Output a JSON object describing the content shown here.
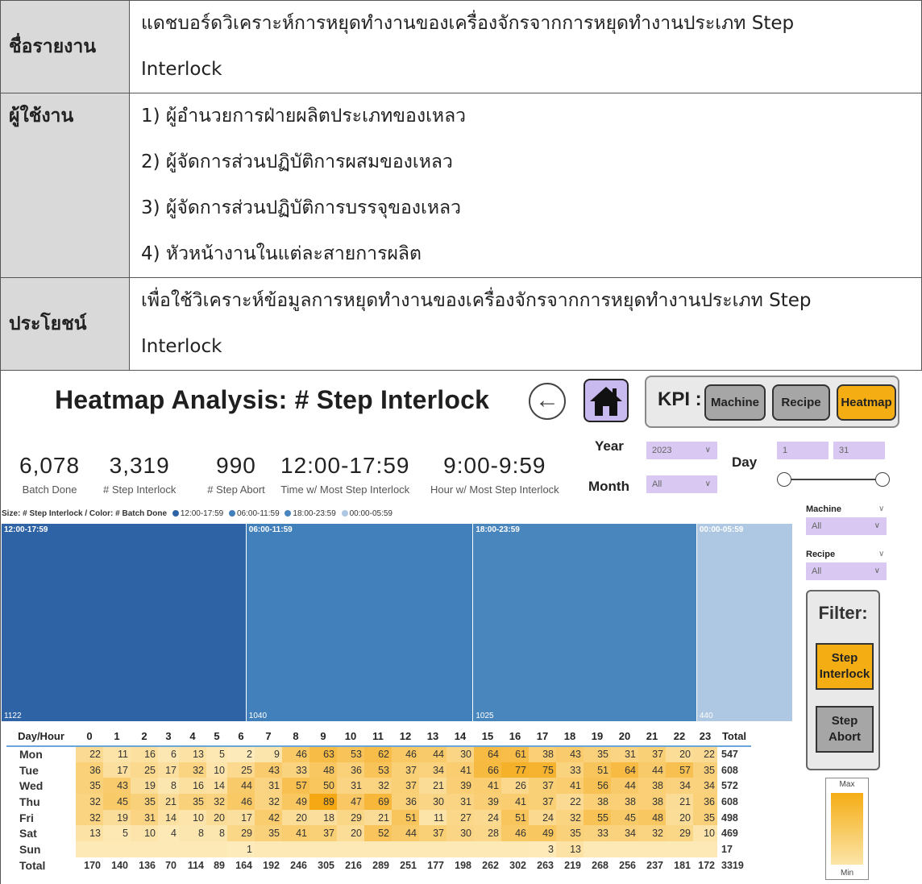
{
  "report": {
    "name_label": "ชื่อรายงาน",
    "name_value_1": "แดชบอร์ดวิเคราะห์การหยุดทำงานของเครื่องจักรจากการหยุดทำงานประเภท Step",
    "name_value_2": "Interlock",
    "users_label": "ผู้ใช้งาน",
    "users": [
      "1) ผู้อำนวยการฝ่ายผลิตประเภทของเหลว",
      "2) ผู้จัดการส่วนปฏิบัติการผสมของเหลว",
      "3) ผู้จัดการส่วนปฏิบัติการบรรจุของเหลว",
      "4) หัวหน้างานในแต่ละสายการผลิต"
    ],
    "benefit_label": "ประโยชน์",
    "benefit_value_1": "เพื่อใช้วิเคราะห์ข้อมูลการหยุดทำงานของเครื่องจักรจากการหยุดทำงานประเภท Step",
    "benefit_value_2": "Interlock"
  },
  "dashboard": {
    "title": "Heatmap Analysis: # Step Interlock",
    "back_icon": "arrow-left-circle-icon",
    "home_icon": "home-icon",
    "kpi": {
      "label": "KPI :",
      "buttons": [
        "Machine",
        "Recipe",
        "Heatmap"
      ],
      "active": "Heatmap"
    },
    "cards": [
      {
        "value": "6,078",
        "label": "Batch Done"
      },
      {
        "value": "3,319",
        "label": "# Step Interlock"
      },
      {
        "value": "990",
        "label": "# Step Abort"
      },
      {
        "value": "12:00-17:59",
        "label": "Time w/ Most Step Interlock"
      },
      {
        "value": "9:00-9:59",
        "label": "Hour w/ Most Step Interlock"
      }
    ],
    "filters": {
      "year_label": "Year",
      "year_value": "2023",
      "month_label": "Month",
      "month_value": "All",
      "day_label": "Day",
      "day_min": "1",
      "day_max": "31",
      "machine_label": "Machine",
      "machine_value": "All",
      "recipe_label": "Recipe",
      "recipe_value": "All"
    },
    "legend": {
      "title": "Size: # Step Interlock / Color: # Batch Done",
      "items": [
        "12:00-17:59",
        "06:00-11:59",
        "18:00-23:59",
        "00:00-05:59"
      ]
    },
    "filter_box": {
      "title": "Filter:",
      "buttons": [
        "Step Interlock",
        "Step Abort"
      ],
      "active": "Step Interlock"
    },
    "gauge": {
      "max": "Max",
      "min": "Min"
    },
    "colors": {
      "accent": "#f5ad14",
      "slicer": "#d9c9f2",
      "tm1": "#2e64a6",
      "tm2": "#4180bb",
      "tm3": "#4a86be",
      "tm4": "#aec7e2"
    }
  },
  "chart_data": [
    {
      "type": "treemap",
      "items": [
        {
          "label": "12:00-17:59",
          "value": 1122,
          "color": "#2e64a6"
        },
        {
          "label": "06:00-11:59",
          "value": 1040,
          "color": "#4180bb"
        },
        {
          "label": "18:00-23:59",
          "value": 1025,
          "color": "#4a86be"
        },
        {
          "label": "00:00-05:59",
          "value": 440,
          "color": "#aec7e2"
        }
      ]
    },
    {
      "type": "heatmap",
      "corner": "Day/Hour",
      "columns": [
        "0",
        "1",
        "2",
        "3",
        "4",
        "5",
        "6",
        "7",
        "8",
        "9",
        "10",
        "11",
        "12",
        "13",
        "14",
        "15",
        "16",
        "17",
        "18",
        "19",
        "20",
        "21",
        "22",
        "23"
      ],
      "total_label": "Total",
      "rows": [
        {
          "day": "Mon",
          "values": [
            22,
            11,
            16,
            6,
            13,
            5,
            2,
            9,
            46,
            63,
            53,
            62,
            46,
            44,
            30,
            64,
            61,
            38,
            43,
            35,
            31,
            37,
            20,
            22
          ],
          "total": 547
        },
        {
          "day": "Tue",
          "values": [
            36,
            17,
            25,
            17,
            32,
            10,
            25,
            43,
            33,
            48,
            36,
            53,
            37,
            34,
            41,
            66,
            77,
            75,
            33,
            51,
            64,
            44,
            57,
            35
          ],
          "total": 608
        },
        {
          "day": "Wed",
          "values": [
            35,
            43,
            19,
            8,
            16,
            14,
            44,
            31,
            57,
            50,
            31,
            32,
            37,
            21,
            39,
            41,
            26,
            37,
            41,
            56,
            44,
            38,
            34,
            34
          ],
          "total": 572
        },
        {
          "day": "Thu",
          "values": [
            32,
            45,
            35,
            21,
            35,
            32,
            46,
            32,
            49,
            89,
            47,
            69,
            36,
            30,
            31,
            39,
            41,
            37,
            22,
            38,
            38,
            38,
            21,
            36
          ],
          "total": 608
        },
        {
          "day": "Fri",
          "values": [
            32,
            19,
            31,
            14,
            10,
            20,
            17,
            42,
            20,
            18,
            29,
            21,
            51,
            11,
            27,
            24,
            51,
            24,
            32,
            55,
            45,
            48,
            20,
            35
          ],
          "total": 498
        },
        {
          "day": "Sat",
          "values": [
            13,
            5,
            10,
            4,
            8,
            8,
            29,
            35,
            41,
            37,
            20,
            52,
            44,
            37,
            30,
            28,
            46,
            49,
            35,
            33,
            34,
            32,
            29,
            10
          ],
          "total": 469
        },
        {
          "day": "Sun",
          "values": [
            null,
            null,
            null,
            null,
            null,
            null,
            1,
            null,
            null,
            null,
            null,
            null,
            null,
            null,
            null,
            null,
            null,
            3,
            13,
            null,
            null,
            null,
            null,
            null
          ],
          "total": 17
        }
      ],
      "column_totals": [
        170,
        140,
        136,
        70,
        114,
        89,
        164,
        192,
        246,
        305,
        216,
        289,
        251,
        177,
        198,
        262,
        302,
        263,
        219,
        268,
        256,
        237,
        181,
        172
      ],
      "grand_total": 3319
    }
  ]
}
